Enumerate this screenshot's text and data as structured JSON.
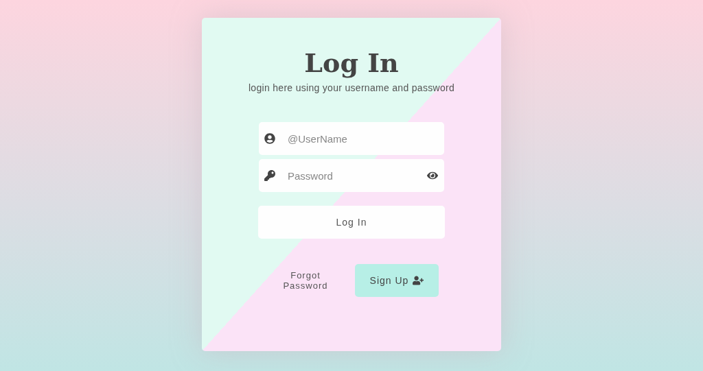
{
  "title": "Log In",
  "subtitle": "login here using your username and password",
  "fields": [
    {
      "kind": "username",
      "placeholder": "@UserName"
    },
    {
      "kind": "password",
      "placeholder": "Password"
    }
  ],
  "login_button": "Log In",
  "forgot_link": "Forgot Password",
  "signup_button": "Sign Up"
}
